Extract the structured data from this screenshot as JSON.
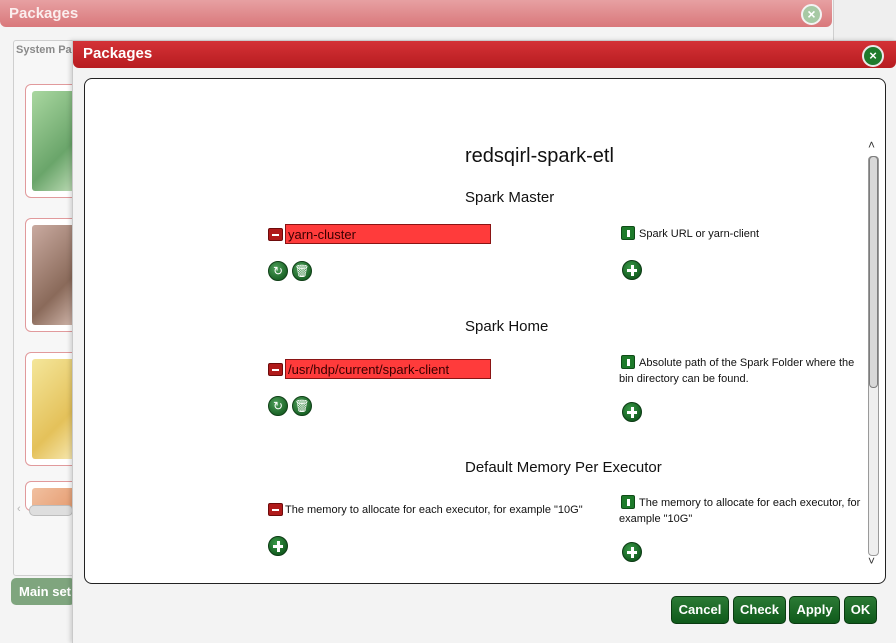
{
  "background_window": {
    "title": "Packages",
    "tab_label": "System Pa",
    "main_button_label": "Main set"
  },
  "dialog": {
    "title": "Packages",
    "package_name": "redsqirl-spark-etl",
    "sections": [
      {
        "title": "Spark Master",
        "value": "yarn-cluster",
        "description": "Spark URL or yarn-client"
      },
      {
        "title": "Spark Home",
        "value": "/usr/hdp/current/spark-client",
        "description": "Absolute path of the Spark Folder where the bin directory can be found."
      },
      {
        "title": "Default Memory Per Executor",
        "field_description": "The memory to allocate for each executor, for example \"10G\"",
        "description": "The memory to allocate for each executor, for example \"10G\""
      }
    ],
    "buttons": {
      "cancel": "Cancel",
      "check": "Check",
      "apply": "Apply",
      "ok": "OK"
    }
  },
  "icons": {
    "close": "close-icon",
    "remove": "minus-icon",
    "reset": "refresh-icon",
    "delete": "trash-icon",
    "add": "plus-icon",
    "help": "info-icon"
  },
  "colors": {
    "titlebar": "#c1252a",
    "field_invalid": "#ff3b3b",
    "button_green": "#1b6a27"
  }
}
